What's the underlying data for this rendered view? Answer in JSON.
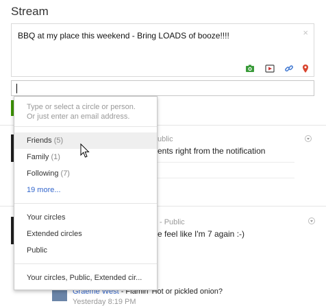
{
  "stream": {
    "title": "Stream"
  },
  "composer": {
    "text": "BBQ at my place this weekend - Bring LOADS of booze!!!!",
    "close": "×"
  },
  "circle_picker": {
    "hint_line1": "Type or select a circle or person.",
    "hint_line2": "Or just enter an email address.",
    "groups": [
      {
        "label": "Friends",
        "count": "(5)"
      },
      {
        "label": "Family",
        "count": "(1)"
      },
      {
        "label": "Following",
        "count": "(7)"
      }
    ],
    "more": "19 more...",
    "options": [
      "Your circles",
      "Extended circles",
      "Public"
    ],
    "combined": "Your circles, Public, Extended cir..."
  },
  "posts": [
    {
      "visibility": "ublic",
      "text": "ents right from the notification"
    },
    {
      "visibility": "-  Public",
      "text": "e feel like I'm 7 again :-)"
    }
  ],
  "comment": {
    "author": "Graeme West",
    "text": " - Flamin' Hot or pickled onion?",
    "time": "Yesterday 8:19 PM"
  }
}
